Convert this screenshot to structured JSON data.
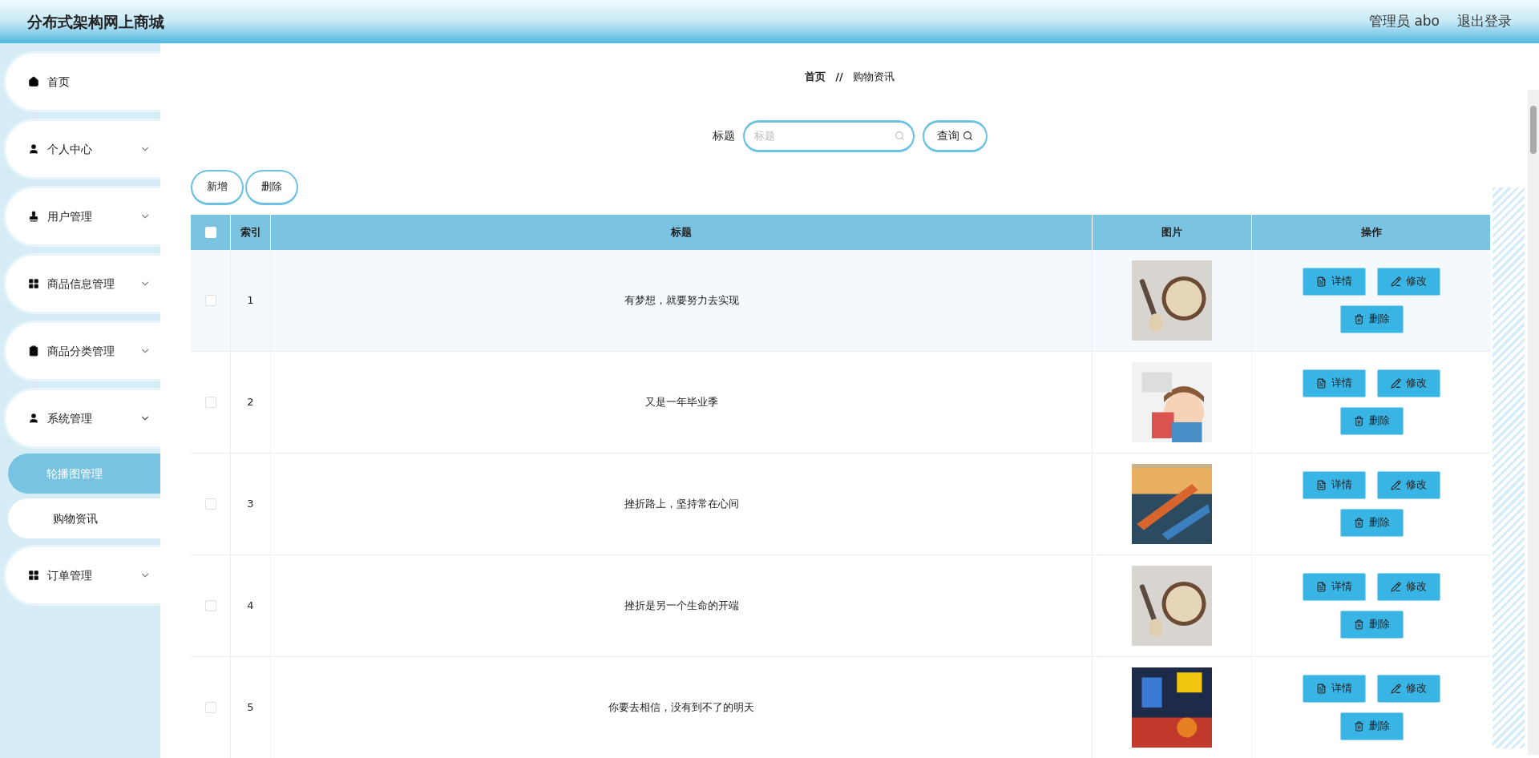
{
  "header": {
    "title": "分布式架构网上商城",
    "user": "管理员 abo",
    "logout": "退出登录"
  },
  "sidebar": {
    "items": [
      {
        "label": "首页"
      },
      {
        "label": "个人中心",
        "expanded": false
      },
      {
        "label": "用户管理",
        "expanded": false
      },
      {
        "label": "商品信息管理",
        "expanded": false
      },
      {
        "label": "商品分类管理",
        "expanded": false
      },
      {
        "label": "系统管理",
        "expanded": true,
        "children": [
          {
            "label": "轮播图管理",
            "selected": true
          },
          {
            "label": "购物资讯",
            "selected": false
          }
        ]
      },
      {
        "label": "订单管理",
        "expanded": false
      }
    ]
  },
  "breadcrumb": {
    "home": "首页",
    "separator": "//",
    "current": "购物资讯"
  },
  "search": {
    "label": "标题",
    "placeholder": "标题",
    "button": "查询"
  },
  "actions": [
    "新增",
    "删除"
  ],
  "table": {
    "select_all_checked": false,
    "columns": [
      "索引",
      "标题",
      "图片",
      "操作"
    ],
    "rows": [
      {
        "index": "1",
        "title": "有梦想，就要努力去实现",
        "checked": false,
        "highlighted": true,
        "buttons": [
          "详情",
          "修改",
          "删除"
        ]
      },
      {
        "index": "2",
        "title": "又是一年毕业季",
        "checked": false,
        "highlighted": false,
        "buttons": [
          "详情",
          "修改",
          "删除"
        ]
      },
      {
        "index": "3",
        "title": "挫折路上，坚持常在心间",
        "checked": false,
        "highlighted": false,
        "buttons": [
          "详情",
          "修改",
          "删除"
        ]
      },
      {
        "index": "4",
        "title": "挫折是另一个生命的开端",
        "checked": false,
        "highlighted": false,
        "buttons": [
          "详情",
          "修改",
          "删除"
        ]
      },
      {
        "index": "5",
        "title": "你要去相信，没有到不了的明天",
        "checked": false,
        "highlighted": false,
        "buttons": [
          "详情",
          "修改",
          "删除"
        ]
      }
    ]
  }
}
